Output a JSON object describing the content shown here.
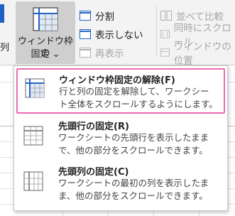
{
  "ribbon": {
    "left_partial_label": "列",
    "freeze_button": {
      "line1": "ウィンドウ枠の",
      "line2": "固定 ⌄"
    },
    "commands": {
      "split": "分割",
      "hide": "表示しない",
      "unhide": "再表示",
      "side_by_side": "並べて比較",
      "sync_scroll": "同時にスクロール",
      "reset_position": "ウィンドウの位置"
    }
  },
  "menu": {
    "items": [
      {
        "title": "ウィンドウ枠固定の解除(F)",
        "desc1": "行と列の固定を解除して、ワークシー",
        "desc2": "ト全体をスクロールするようにします。"
      },
      {
        "title": "先頭行の固定(R)",
        "desc1": "ワークシートの先頭行を表示したまま",
        "desc2": "で、他の部分をスクロールできます。"
      },
      {
        "title": "先頭列の固定(C)",
        "desc1": "ワークシートの最初の列を表示したま",
        "desc2": "ま、他の部分をスクロールできます。"
      }
    ]
  },
  "colors": {
    "accent_blue": "#1f62c6",
    "highlight_pink": "#ea6bb1"
  }
}
